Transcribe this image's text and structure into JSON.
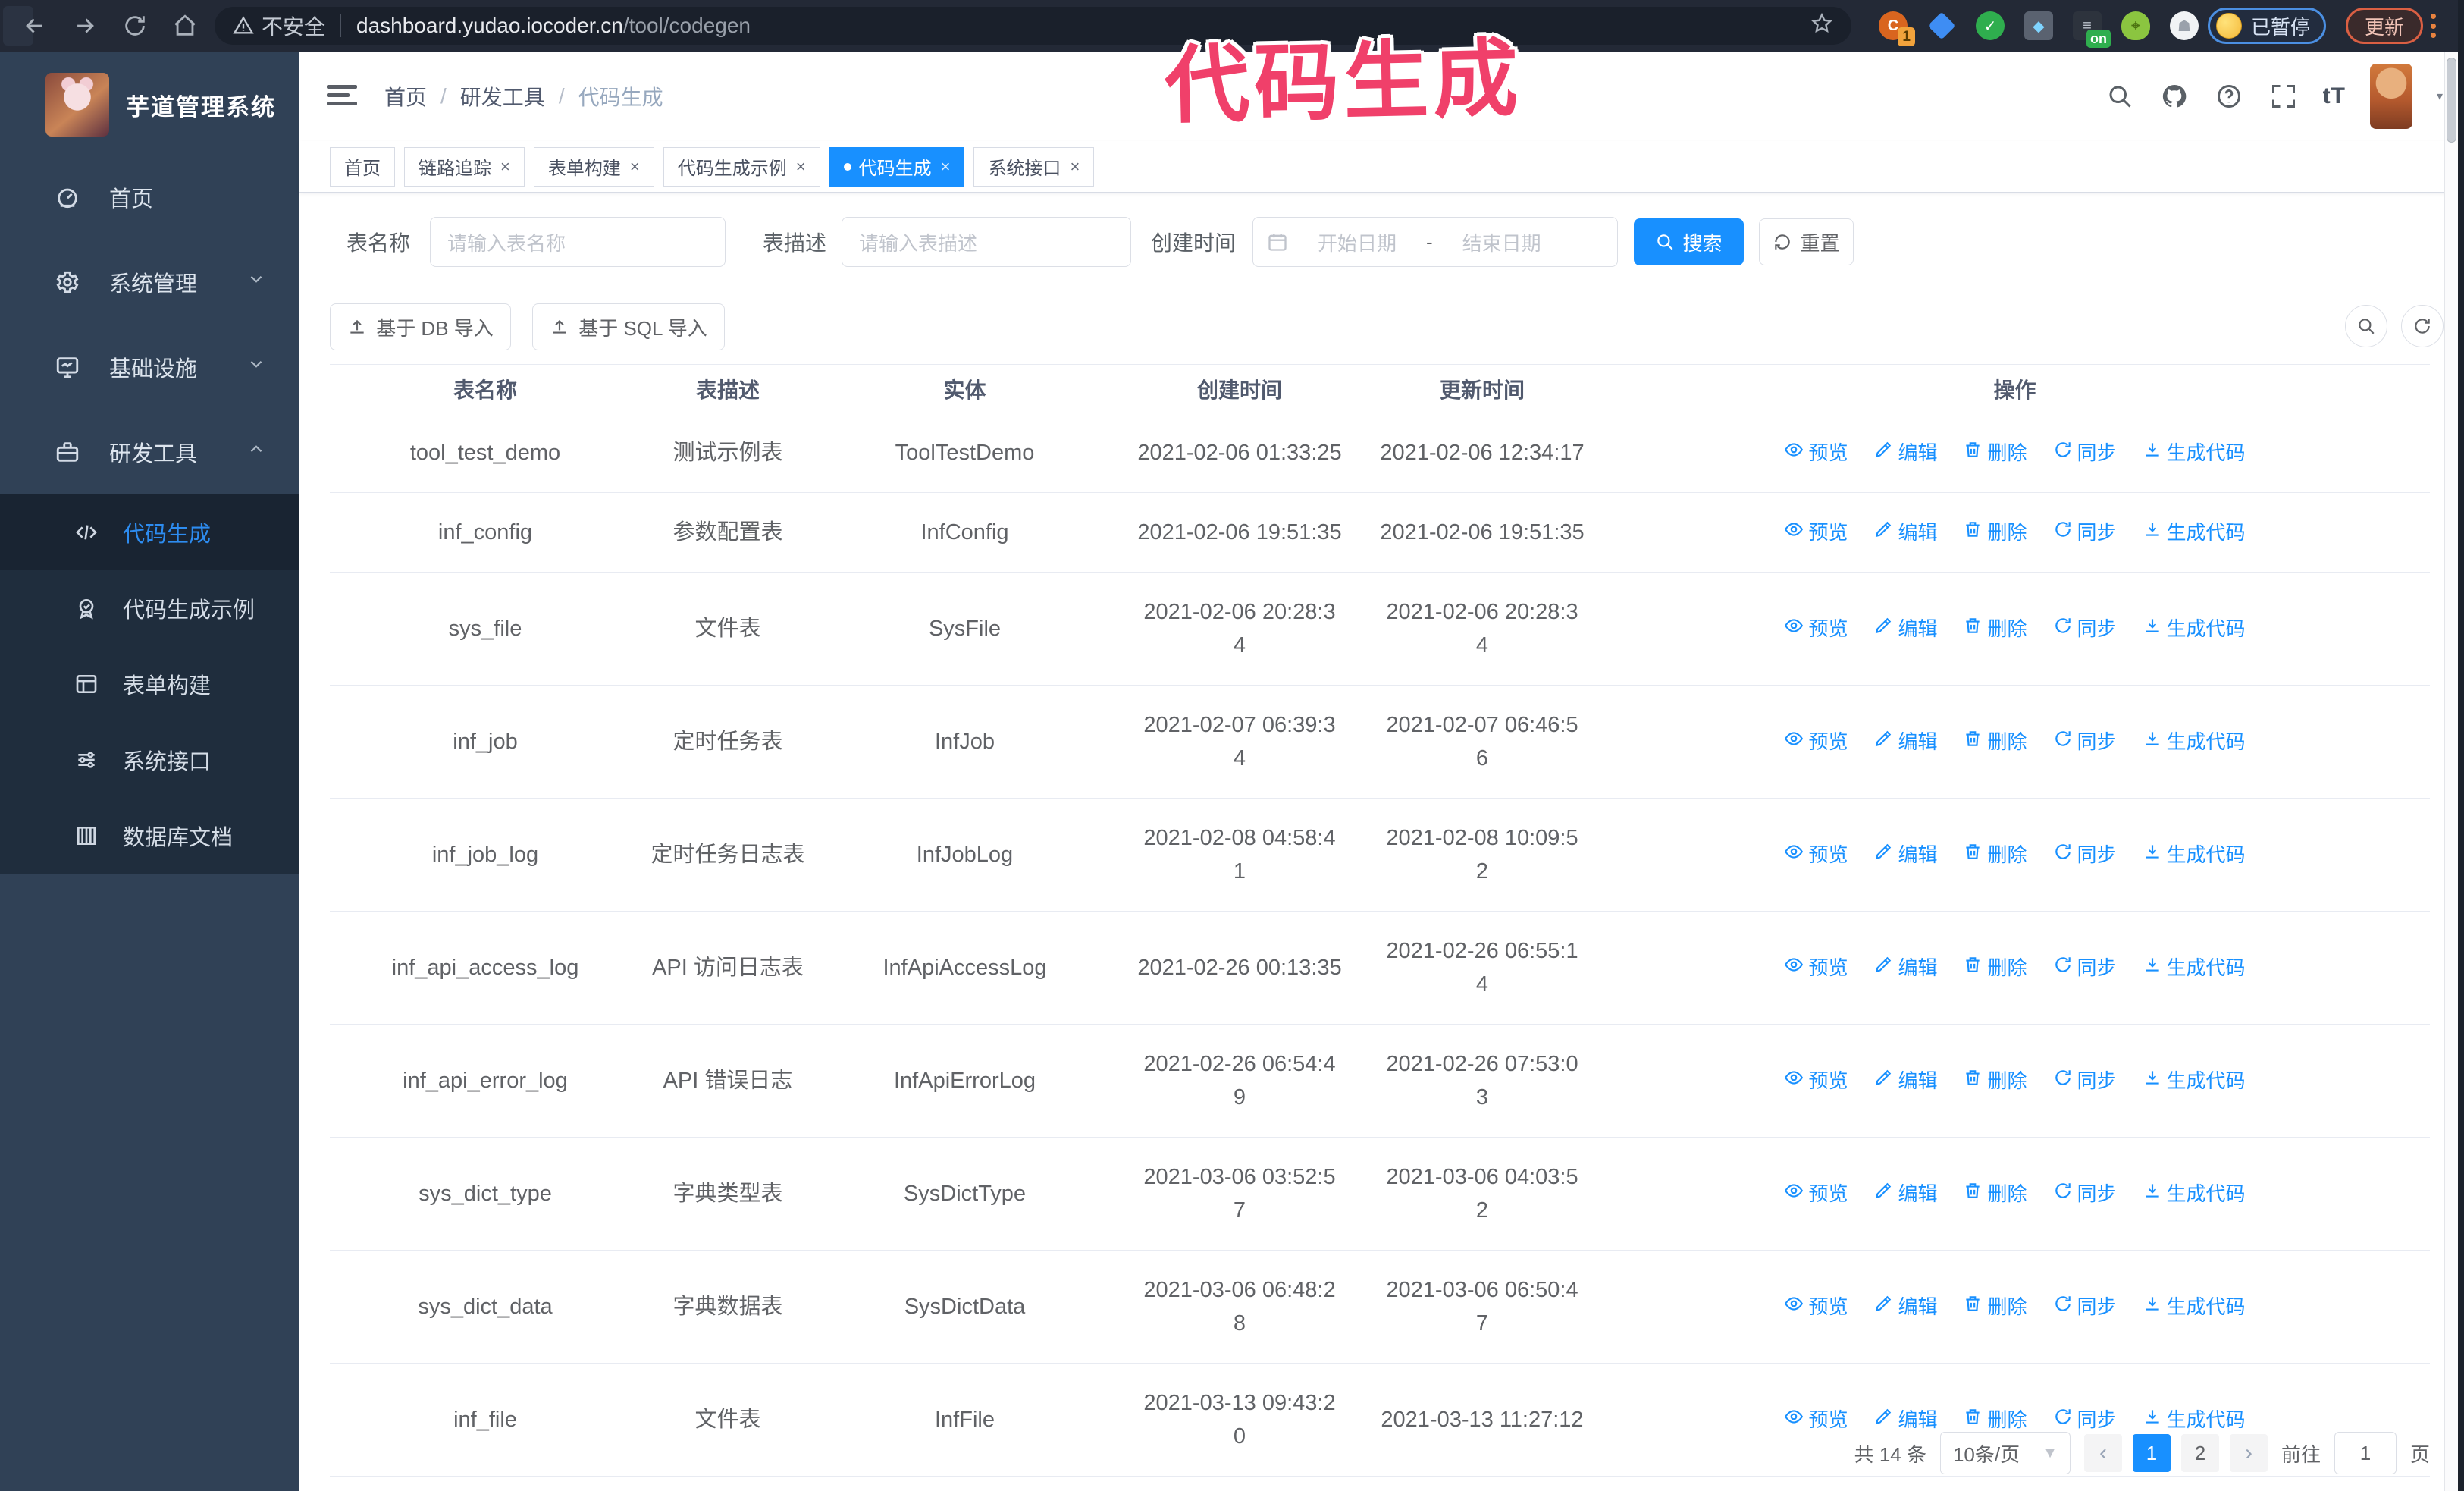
{
  "annotation": {
    "text": "代码生成",
    "color": "#f0406a"
  },
  "browser": {
    "security_chip": "不安全",
    "url_host": "dashboard.yudao.iocoder.cn",
    "url_path": "/tool/codegen",
    "extension_badge": "1",
    "extension_on_badge": "on",
    "paused_badge": "已暂停",
    "update_button": "更新"
  },
  "sidebar": {
    "logo_title": "芋道管理系统",
    "items": [
      {
        "label": "首页",
        "icon": "dashboard",
        "chevron": ""
      },
      {
        "label": "系统管理",
        "icon": "gear",
        "chevron": "down"
      },
      {
        "label": "基础设施",
        "icon": "monitor",
        "chevron": "down"
      },
      {
        "label": "研发工具",
        "icon": "toolbox",
        "chevron": "up"
      }
    ],
    "submenu": [
      {
        "label": "代码生成",
        "icon": "code",
        "active": true
      },
      {
        "label": "代码生成示例",
        "icon": "medal",
        "active": false
      },
      {
        "label": "表单构建",
        "icon": "form",
        "active": false
      },
      {
        "label": "系统接口",
        "icon": "sliders",
        "active": false
      },
      {
        "label": "数据库文档",
        "icon": "db",
        "active": false
      }
    ]
  },
  "header": {
    "breadcrumb": [
      "首页",
      "研发工具",
      "代码生成"
    ]
  },
  "tabs": [
    {
      "label": "首页",
      "closable": false,
      "active": false
    },
    {
      "label": "链路追踪",
      "closable": true,
      "active": false
    },
    {
      "label": "表单构建",
      "closable": true,
      "active": false
    },
    {
      "label": "代码生成示例",
      "closable": true,
      "active": false
    },
    {
      "label": "代码生成",
      "closable": true,
      "active": true
    },
    {
      "label": "系统接口",
      "closable": true,
      "active": false
    }
  ],
  "filters": {
    "name_label": "表名称",
    "name_placeholder": "请输入表名称",
    "desc_label": "表描述",
    "desc_placeholder": "请输入表描述",
    "time_label": "创建时间",
    "start_placeholder": "开始日期",
    "range_dash": "-",
    "end_placeholder": "结束日期",
    "search_label": "搜索",
    "reset_label": "重置"
  },
  "toolbar": {
    "import_db_label": "基于 DB 导入",
    "import_sql_label": "基于 SQL 导入"
  },
  "table": {
    "columns": [
      "表名称",
      "表描述",
      "实体",
      "创建时间",
      "更新时间",
      "操作"
    ],
    "actions": [
      "预览",
      "编辑",
      "删除",
      "同步",
      "生成代码"
    ],
    "rows": [
      {
        "name": "tool_test_demo",
        "desc": "测试示例表",
        "entity": "ToolTestDemo",
        "created": "2021-02-06 01:33:25",
        "updated": "2021-02-06 12:34:17"
      },
      {
        "name": "inf_config",
        "desc": "参数配置表",
        "entity": "InfConfig",
        "created": "2021-02-06 19:51:35",
        "updated": "2021-02-06 19:51:35"
      },
      {
        "name": "sys_file",
        "desc": "文件表",
        "entity": "SysFile",
        "created": "2021-02-06 20:28:3\n4",
        "updated": "2021-02-06 20:28:3\n4"
      },
      {
        "name": "inf_job",
        "desc": "定时任务表",
        "entity": "InfJob",
        "created": "2021-02-07 06:39:3\n4",
        "updated": "2021-02-07 06:46:5\n6"
      },
      {
        "name": "inf_job_log",
        "desc": "定时任务日志表",
        "entity": "InfJobLog",
        "created": "2021-02-08 04:58:4\n1",
        "updated": "2021-02-08 10:09:5\n2"
      },
      {
        "name": "inf_api_access_log",
        "desc": "API 访问日志表",
        "entity": "InfApiAccessLog",
        "created": "2021-02-26 00:13:35",
        "updated": "2021-02-26 06:55:1\n4"
      },
      {
        "name": "inf_api_error_log",
        "desc": "API 错误日志",
        "entity": "InfApiErrorLog",
        "created": "2021-02-26 06:54:4\n9",
        "updated": "2021-02-26 07:53:0\n3"
      },
      {
        "name": "sys_dict_type",
        "desc": "字典类型表",
        "entity": "SysDictType",
        "created": "2021-03-06 03:52:5\n7",
        "updated": "2021-03-06 04:03:5\n2"
      },
      {
        "name": "sys_dict_data",
        "desc": "字典数据表",
        "entity": "SysDictData",
        "created": "2021-03-06 06:48:2\n8",
        "updated": "2021-03-06 06:50:4\n7"
      },
      {
        "name": "inf_file",
        "desc": "文件表",
        "entity": "InfFile",
        "created": "2021-03-13 09:43:2\n0",
        "updated": "2021-03-13 11:27:12"
      }
    ]
  },
  "pagination": {
    "total_label": "共 14 条",
    "page_size": "10条/页",
    "prev": "‹",
    "pages": [
      "1",
      "2"
    ],
    "active_page": "1",
    "next": "›",
    "goto_label": "前往",
    "goto_value": "1",
    "goto_suffix": "页"
  },
  "colors": {
    "primary": "#1890ff",
    "sidebar_bg": "#304156",
    "submenu_bg": "#1f2d3d",
    "chrome_bg": "#232936",
    "annotation_pink": "#f0406a"
  }
}
